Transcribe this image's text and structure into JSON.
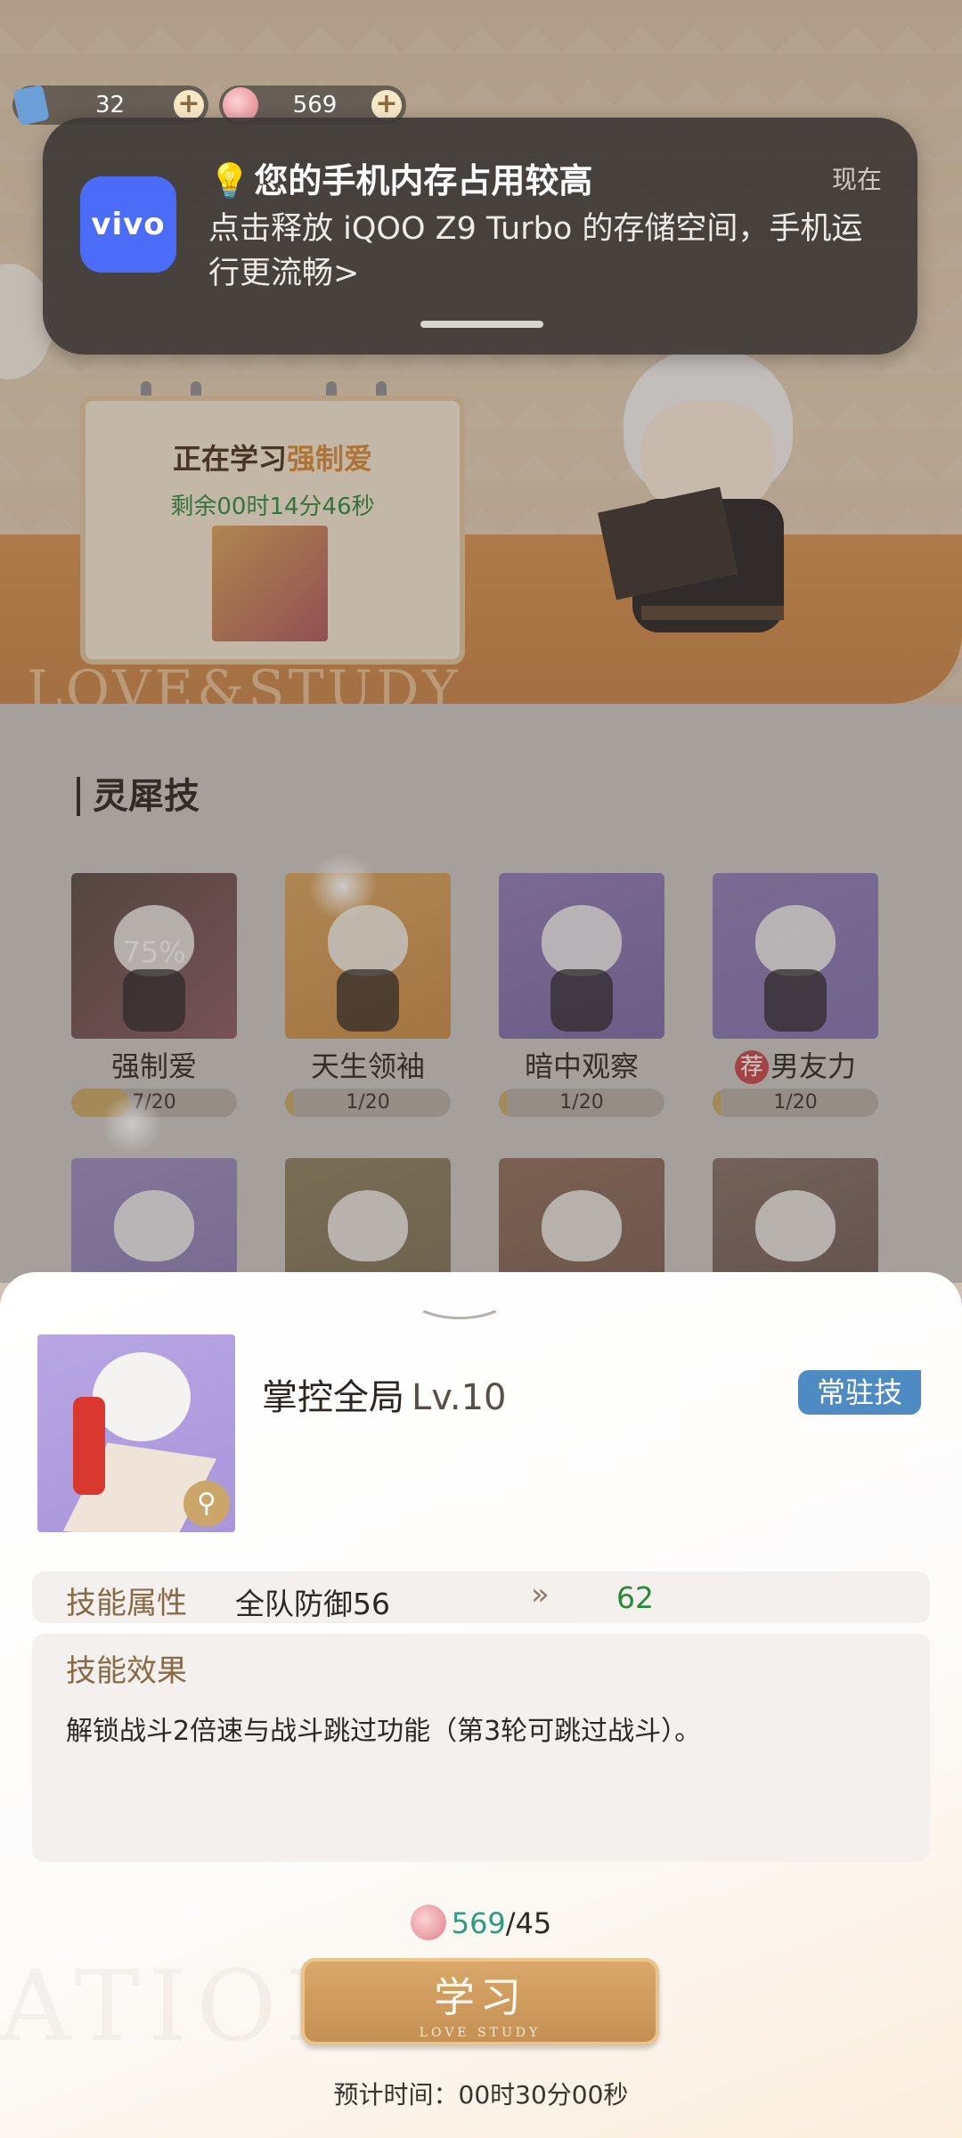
{
  "currency": {
    "tickets": "32",
    "gems": "569"
  },
  "notification": {
    "app_name": "vivo",
    "title": "您的手机内存占用较高",
    "time": "现在",
    "body": "点击释放 iQOO Z9 Turbo 的存储空间，手机运行更流畅>"
  },
  "study": {
    "prefix": "正在学习",
    "skill": "强制爱",
    "remaining": "剩余00时14分46秒",
    "background_text": "LOVE&STUDY"
  },
  "skills_section": {
    "title": "灵犀技",
    "items": [
      {
        "name": "强制爱",
        "progress": "7/20",
        "progress_fraction": 0.35,
        "overlay": "75%",
        "recommended": false
      },
      {
        "name": "天生领袖",
        "progress": "1/20",
        "progress_fraction": 0.05,
        "recommended": false
      },
      {
        "name": "暗中观察",
        "progress": "1/20",
        "progress_fraction": 0.05,
        "recommended": false
      },
      {
        "name": "男友力",
        "progress": "1/20",
        "progress_fraction": 0.05,
        "recommended": true,
        "recommended_label": "荐"
      }
    ]
  },
  "detail": {
    "name": "掌控全局",
    "level": "Lv.10",
    "badge": "常驻技",
    "attr_label": "技能属性",
    "attr_value": "全队防御56",
    "attr_arrow": "»",
    "attr_next": "62",
    "effect_label": "技能效果",
    "effect_text": "解锁战斗2倍速与战斗跳过功能（第3轮可跳过战斗）。",
    "cost_have": "569",
    "cost_sep": "/",
    "cost_need": "45",
    "learn_label": "学习",
    "learn_sub": "LOVE STUDY",
    "eta": "预计时间：00时30分00秒"
  },
  "icons": {
    "ticket": "ticket-icon",
    "gem": "gem-icon",
    "plus": "plus-icon",
    "zoom": "magnifier-icon",
    "chevron": "chevron-down-icon"
  },
  "colors": {
    "accent_gold": "#c58f52",
    "vivo_blue": "#4a6cf7",
    "badge_blue": "#4f8bc3",
    "green_value": "#2b8a3a",
    "teal_have": "#2d9a83"
  }
}
